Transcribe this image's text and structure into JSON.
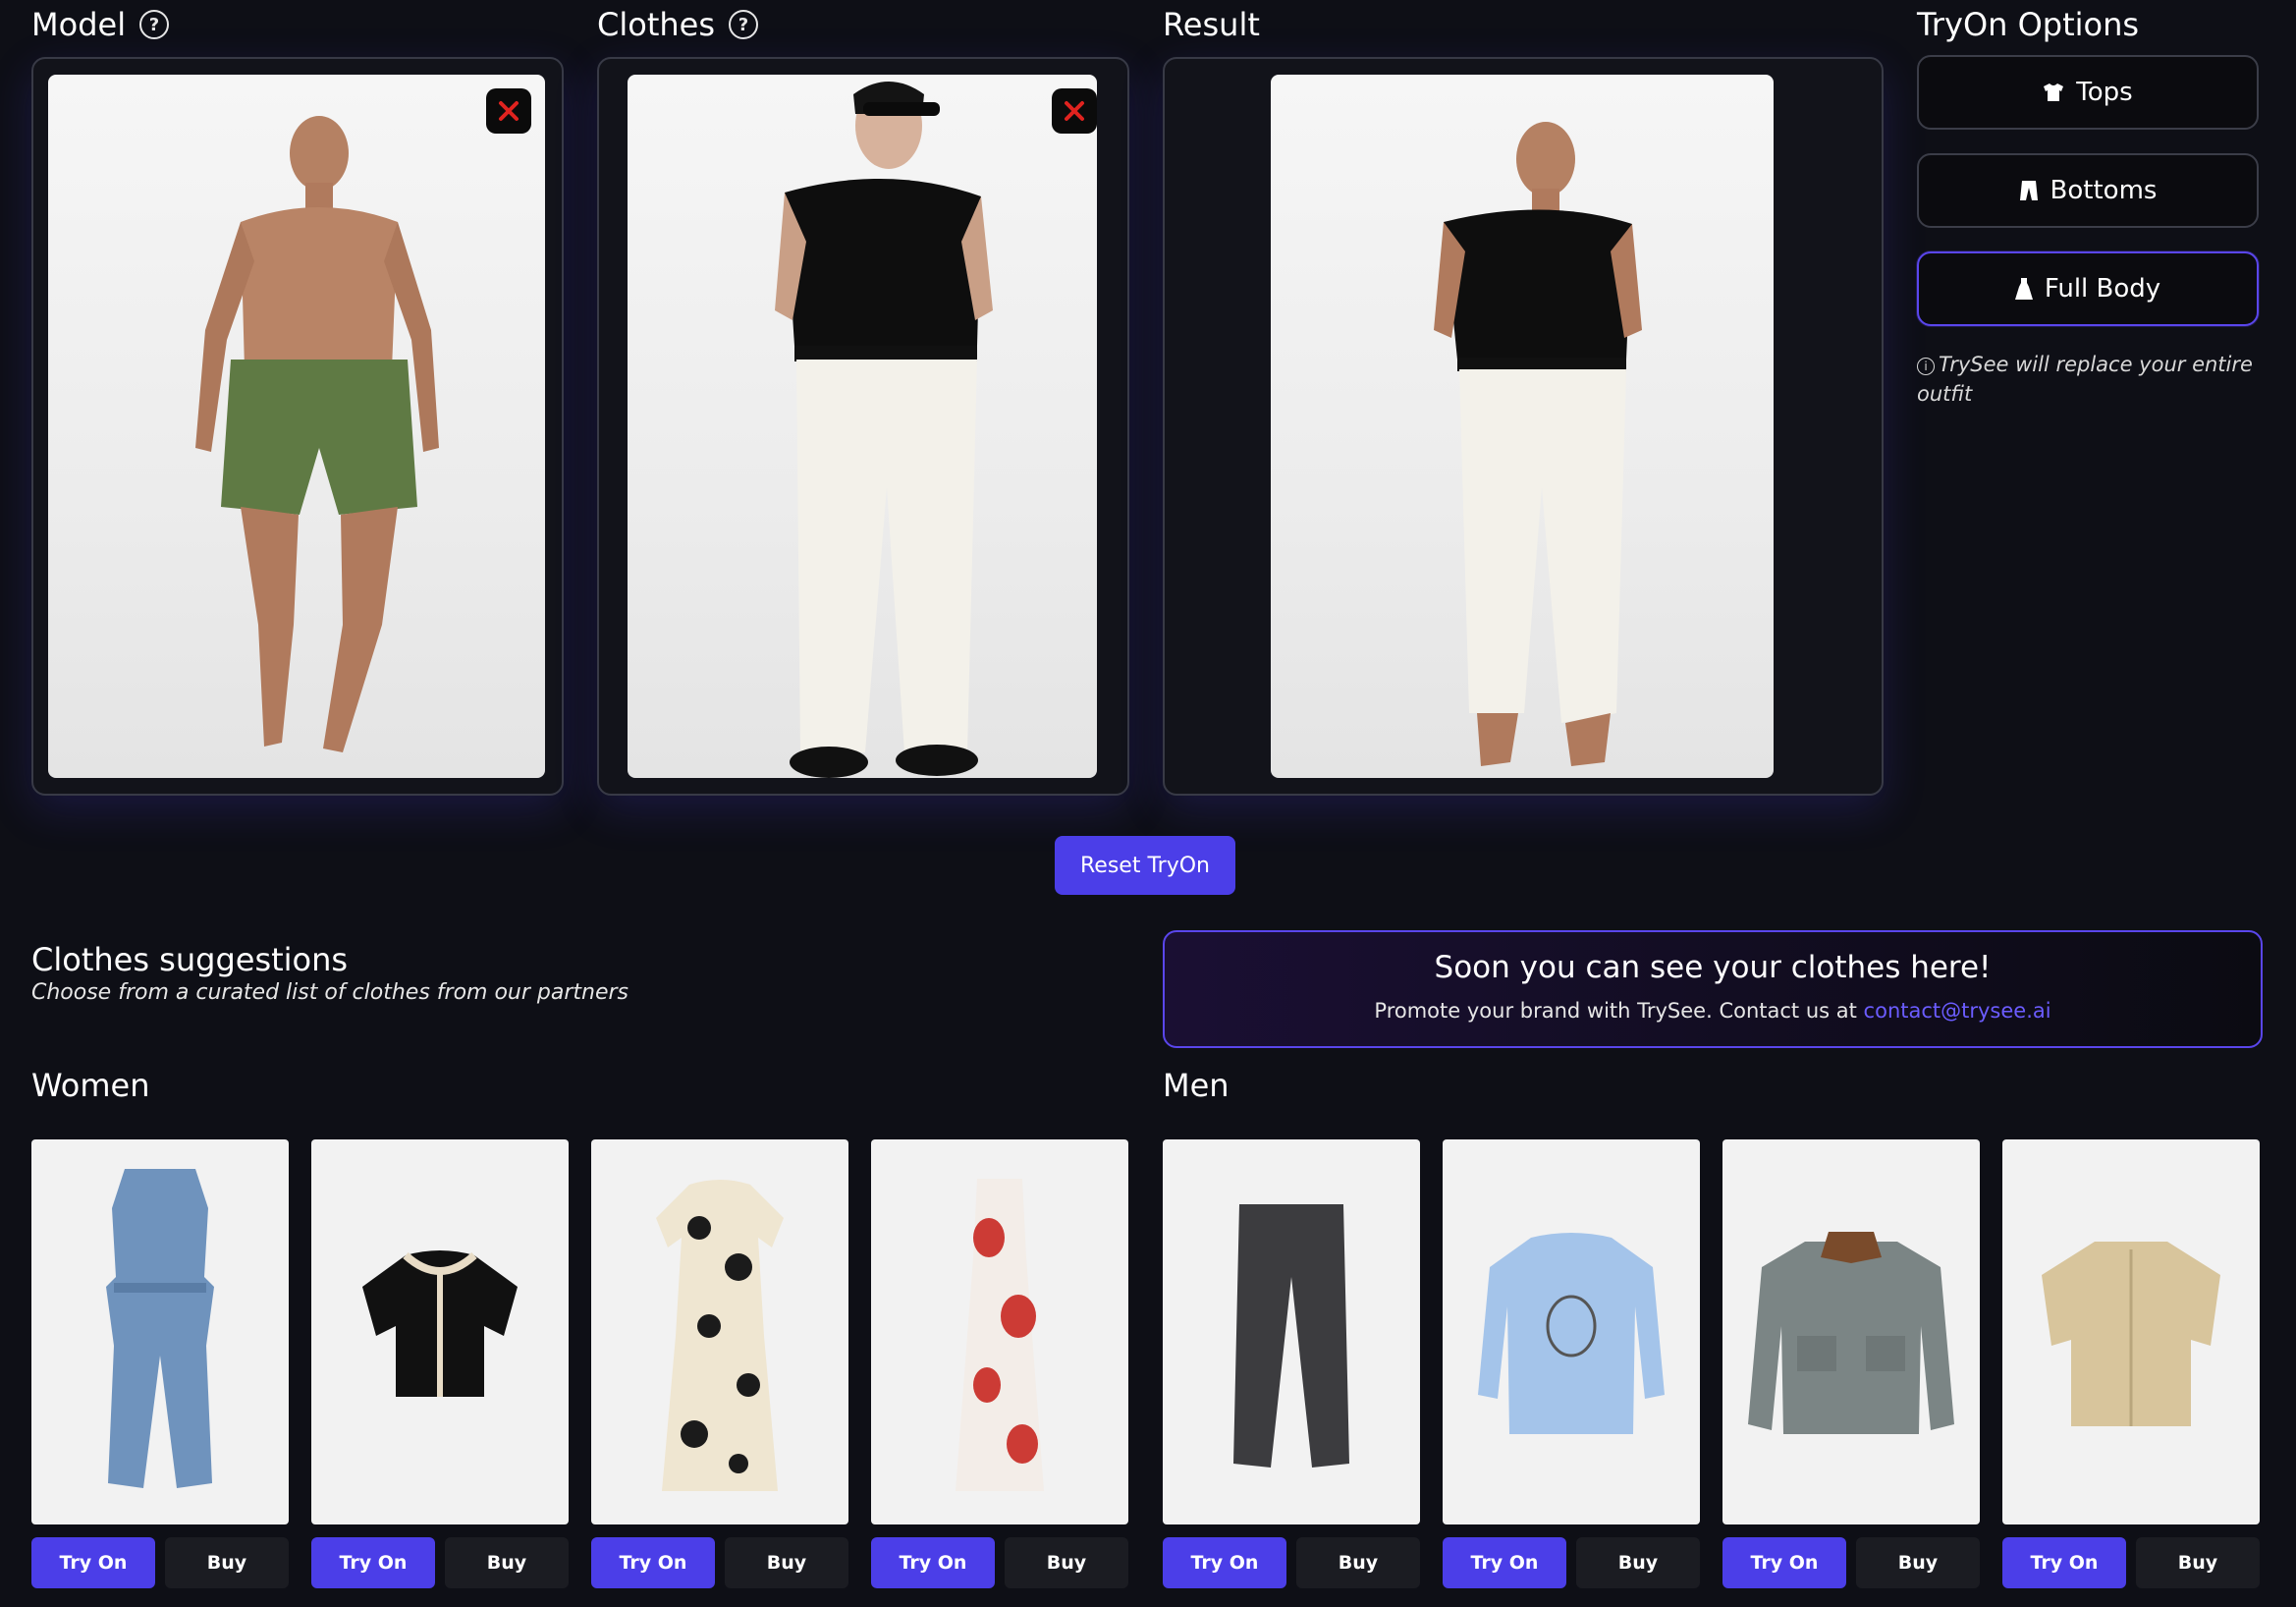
{
  "sections": {
    "model": "Model",
    "clothes": "Clothes",
    "result": "Result",
    "options": "TryOn Options"
  },
  "options": {
    "tops": "Tops",
    "bottoms": "Bottoms",
    "full_body": "Full Body",
    "selected": "Full Body",
    "note": "TrySee will replace your entire outfit"
  },
  "reset_label": "Reset TryOn",
  "suggestions": {
    "title": "Clothes suggestions",
    "subtitle": "Choose from a curated list of clothes from our partners"
  },
  "promo": {
    "title": "Soon you can see your clothes here!",
    "text": "Promote your brand with TrySee. Contact us at",
    "email": "contact@trysee.ai"
  },
  "women": {
    "title": "Women",
    "items": [
      {
        "try": "Try On",
        "buy": "Buy"
      },
      {
        "try": "Try On",
        "buy": "Buy"
      },
      {
        "try": "Try On",
        "buy": "Buy"
      },
      {
        "try": "Try On",
        "buy": "Buy"
      }
    ]
  },
  "men": {
    "title": "Men",
    "items": [
      {
        "try": "Try On",
        "buy": "Buy"
      },
      {
        "try": "Try On",
        "buy": "Buy"
      },
      {
        "try": "Try On",
        "buy": "Buy"
      },
      {
        "try": "Try On",
        "buy": "Buy"
      }
    ]
  },
  "colors": {
    "background": "#0e0f16",
    "accent": "#4b3ee8",
    "link": "#6b5cff",
    "close_x": "#e0231f"
  },
  "icons": [
    "help-icon",
    "close-icon",
    "tshirt-icon",
    "pants-icon",
    "dress-icon",
    "info-icon"
  ]
}
